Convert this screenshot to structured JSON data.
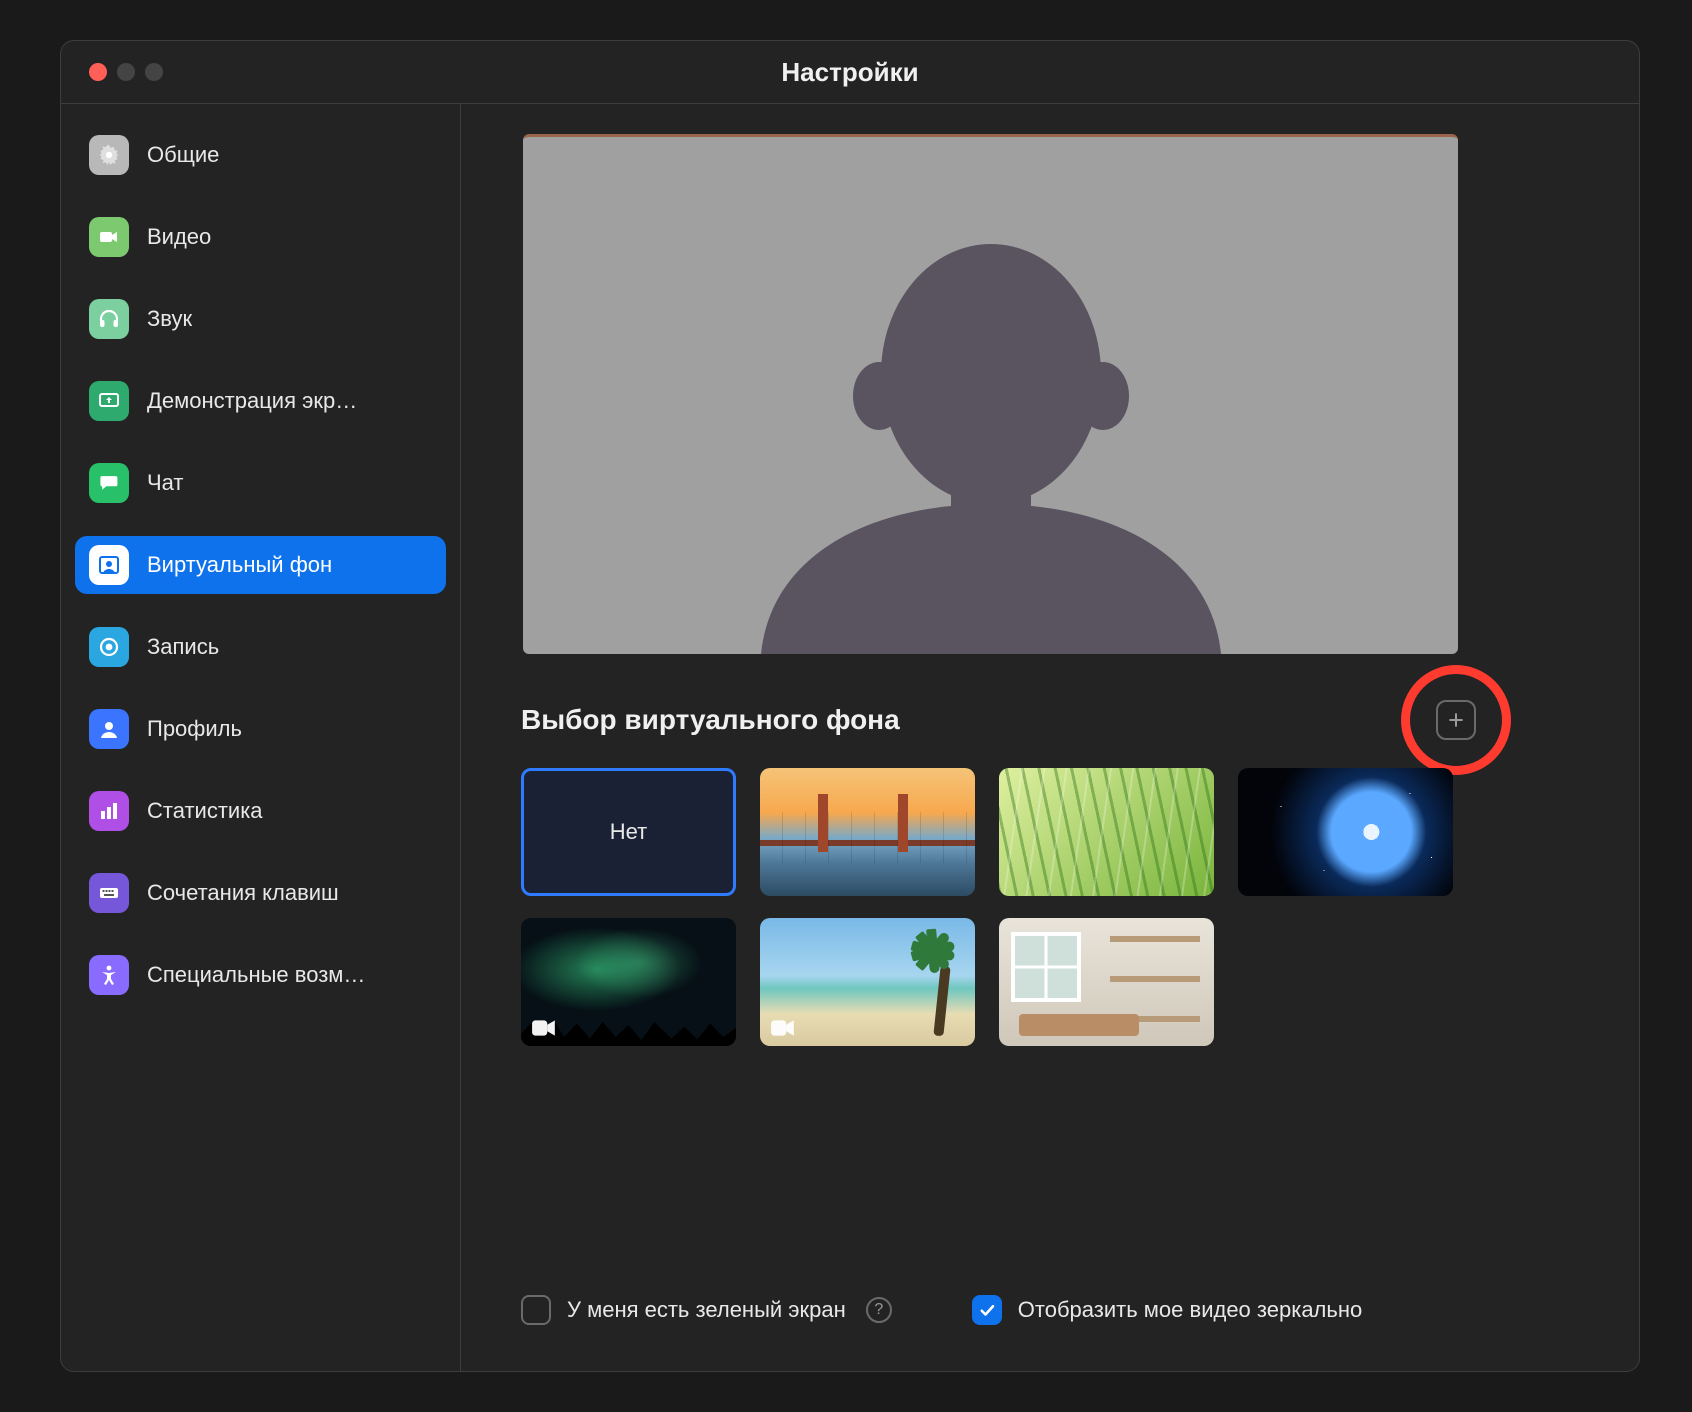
{
  "window": {
    "title": "Настройки"
  },
  "colors": {
    "accent": "#0e72ed",
    "highlight": "#ff3b30"
  },
  "sidebar": {
    "items": [
      {
        "id": "general",
        "label": "Общие",
        "icon": "gear-icon",
        "icon_bg": "#b8b8b8",
        "active": false
      },
      {
        "id": "video",
        "label": "Видео",
        "icon": "video-icon",
        "icon_bg": "#7cc96f",
        "active": false
      },
      {
        "id": "audio",
        "label": "Звук",
        "icon": "headphones-icon",
        "icon_bg": "#7ccf9f",
        "active": false
      },
      {
        "id": "share",
        "label": "Демонстрация экр…",
        "icon": "screen-share-icon",
        "icon_bg": "#2faa6f",
        "active": false
      },
      {
        "id": "chat",
        "label": "Чат",
        "icon": "chat-icon",
        "icon_bg": "#29c06a",
        "active": false
      },
      {
        "id": "vbg",
        "label": "Виртуальный фон",
        "icon": "virtual-bg-icon",
        "icon_bg": "#ffffff",
        "active": true
      },
      {
        "id": "recording",
        "label": "Запись",
        "icon": "record-icon",
        "icon_bg": "#2aa7e0",
        "active": false
      },
      {
        "id": "profile",
        "label": "Профиль",
        "icon": "profile-icon",
        "icon_bg": "#3a74ff",
        "active": false
      },
      {
        "id": "stats",
        "label": "Статистика",
        "icon": "stats-icon",
        "icon_bg": "#b04fe6",
        "active": false
      },
      {
        "id": "shortcuts",
        "label": "Сочетания клавиш",
        "icon": "keyboard-icon",
        "icon_bg": "#7757d9",
        "active": false
      },
      {
        "id": "accessibility",
        "label": "Специальные возм…",
        "icon": "accessibility-icon",
        "icon_bg": "#8a6bff",
        "active": false
      }
    ]
  },
  "main": {
    "section_title": "Выбор виртуального фона",
    "none_label": "Нет",
    "backgrounds": [
      {
        "id": "none",
        "kind": "none",
        "selected": true
      },
      {
        "id": "bridge",
        "kind": "image",
        "name": "golden-gate-bridge"
      },
      {
        "id": "grass",
        "kind": "image",
        "name": "grass-dew"
      },
      {
        "id": "earth",
        "kind": "image",
        "name": "earth-from-space"
      },
      {
        "id": "aurora",
        "kind": "video",
        "name": "aurora-borealis"
      },
      {
        "id": "beach",
        "kind": "video",
        "name": "tropical-beach"
      },
      {
        "id": "room",
        "kind": "image",
        "name": "interior-room"
      }
    ],
    "options": {
      "green_screen": {
        "label": "У меня есть зеленый экран",
        "checked": false,
        "help": true
      },
      "mirror": {
        "label": "Отобразить мое видео зеркально",
        "checked": true
      }
    },
    "add_highlighted": true
  }
}
